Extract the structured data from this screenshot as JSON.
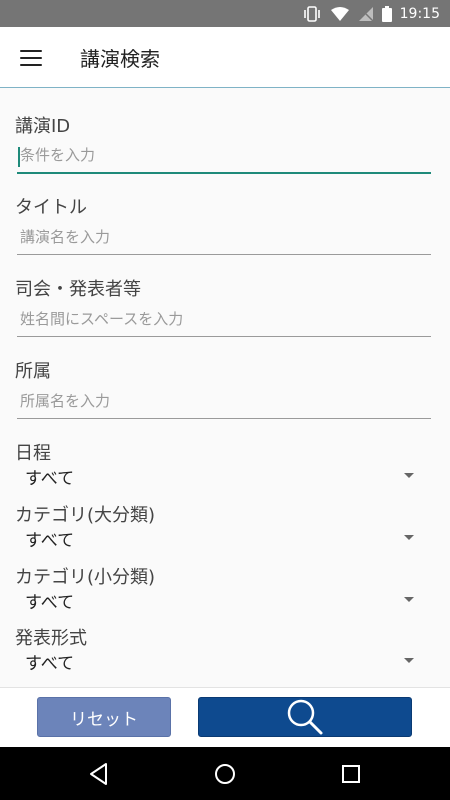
{
  "status_bar": {
    "time": "19:15",
    "icons": [
      "vibrate-icon",
      "wifi-icon",
      "no-signal-icon",
      "battery-icon"
    ]
  },
  "app_bar": {
    "title": "講演検索",
    "menu_icon": "hamburger-menu-icon"
  },
  "form": {
    "lecture_id": {
      "label": "講演ID",
      "placeholder": "条件を入力",
      "value": ""
    },
    "title": {
      "label": "タイトル",
      "placeholder": "講演名を入力",
      "value": ""
    },
    "presenter": {
      "label": "司会・発表者等",
      "placeholder": "姓名間にスペースを入力",
      "value": ""
    },
    "affiliation": {
      "label": "所属",
      "placeholder": "所属名を入力",
      "value": ""
    },
    "schedule": {
      "label": "日程",
      "selected": "すべて"
    },
    "category_major": {
      "label": "カテゴリ(大分類)",
      "selected": "すべて"
    },
    "category_minor": {
      "label": "カテゴリ(小分類)",
      "selected": "すべて"
    },
    "presentation_format": {
      "label": "発表形式",
      "selected": "すべて"
    }
  },
  "actions": {
    "reset_label": "リセット",
    "search_icon": "search-icon"
  },
  "nav_bar": {
    "icons": [
      "back-icon",
      "home-icon",
      "recents-icon"
    ]
  },
  "colors": {
    "accent": "#1e8a7a",
    "primary": "#0e4a8f",
    "reset": "#6c84ba",
    "status_bar": "#757575"
  }
}
